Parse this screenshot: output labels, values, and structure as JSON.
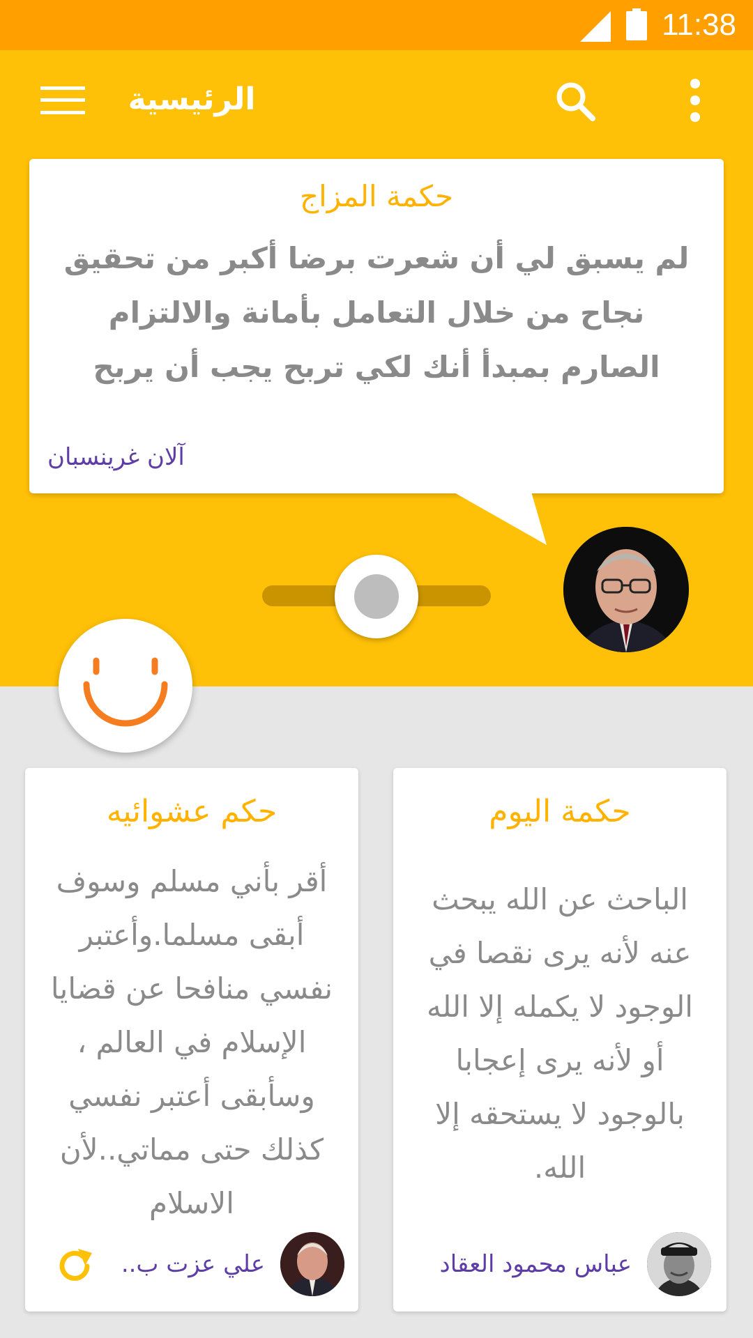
{
  "status_bar": {
    "time": "11:38"
  },
  "app_bar": {
    "title": "الرئيسية"
  },
  "mood_card": {
    "title": "حكمة المزاج",
    "quote": "لم يسبق لي أن شعرت برضا أكبر من تحقيق نجاح من خلال التعامل بأمانة والالتزام الصارم بمبدأ أنك لكي تربح يجب أن يربح كذلك من تعاملهم",
    "author": "آلان غرينسبان"
  },
  "mood_slider": {
    "value": 0.5
  },
  "cards": [
    {
      "title": "حكمة اليوم",
      "quote": "الباحث عن الله يبحث عنه لأنه يرى نقصا في الوجود لا يكمله إلا الله أو لأنه يرى إعجابا بالوجود لا يستحقه إلا الله.",
      "author": "عباس محمود العقاد"
    },
    {
      "title": "حكم عشوائيه",
      "quote": "أقر بأني مسلم وسوف أبقى مسلما.وأعتبر نفسي منافحا عن قضايا الإسلام في العالم ، وسأبقى أعتبر نفسي كذلك حتى مماتي..لأن الاسلام",
      "author": "علي عزت ب.."
    }
  ],
  "colors": {
    "status_bar": "#ffa000",
    "primary": "#ffc107",
    "title_accent": "#ffb300",
    "author_text": "#5e3ea6",
    "body_text": "#8a8a8a",
    "smiley": "#f57c1f",
    "background": "#e6e6e6"
  },
  "icons": [
    "signal-icon",
    "battery-icon",
    "menu-icon",
    "search-icon",
    "more-vert-icon",
    "smiley-icon",
    "refresh-icon"
  ]
}
